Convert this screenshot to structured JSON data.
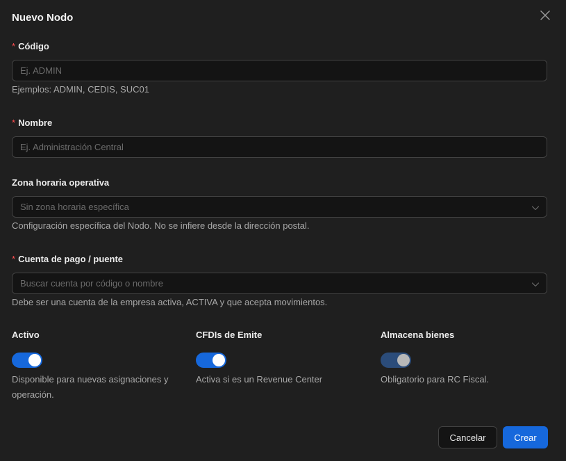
{
  "modal": {
    "title": "Nuevo Nodo"
  },
  "form": {
    "code": {
      "required_mark": "*",
      "label": "Código",
      "placeholder": "Ej. ADMIN",
      "help": "Ejemplos: ADMIN, CEDIS, SUC01"
    },
    "name": {
      "required_mark": "*",
      "label": "Nombre",
      "placeholder": "Ej. Administración Central"
    },
    "timezone": {
      "label": "Zona horaria operativa",
      "placeholder": "Sin zona horaria específica",
      "help": "Configuración específica del Nodo. No se infiere desde la dirección postal."
    },
    "account": {
      "required_mark": "*",
      "label": "Cuenta de pago / puente",
      "placeholder": "Buscar cuenta por código o nombre",
      "help": "Debe ser una cuenta de la empresa activa, ACTIVA y que acepta movimientos."
    },
    "switches": [
      {
        "label": "Activo",
        "checked": true,
        "disabled": false,
        "help_lines": [
          "Disponible para nuevas asignaciones y",
          "operación."
        ]
      },
      {
        "label": "CFDIs de Emite",
        "checked": true,
        "disabled": false,
        "help_lines": [
          "Activa si es un Revenue Center"
        ]
      },
      {
        "label": "Almacena bienes",
        "checked": true,
        "disabled": true,
        "help_lines": [
          "Obligatorio para RC Fiscal."
        ]
      }
    ]
  },
  "footer": {
    "cancel_label": "Cancelar",
    "create_label": "Crear"
  },
  "colors": {
    "background": "#1f1f1f",
    "input_background": "#141414",
    "border": "#424242",
    "primary": "#1668dc",
    "required": "#ff4d4f",
    "help_text": "#a8a8a8"
  },
  "icons": {
    "close": "close-icon",
    "select_arrow": "chevron-down-icon"
  }
}
